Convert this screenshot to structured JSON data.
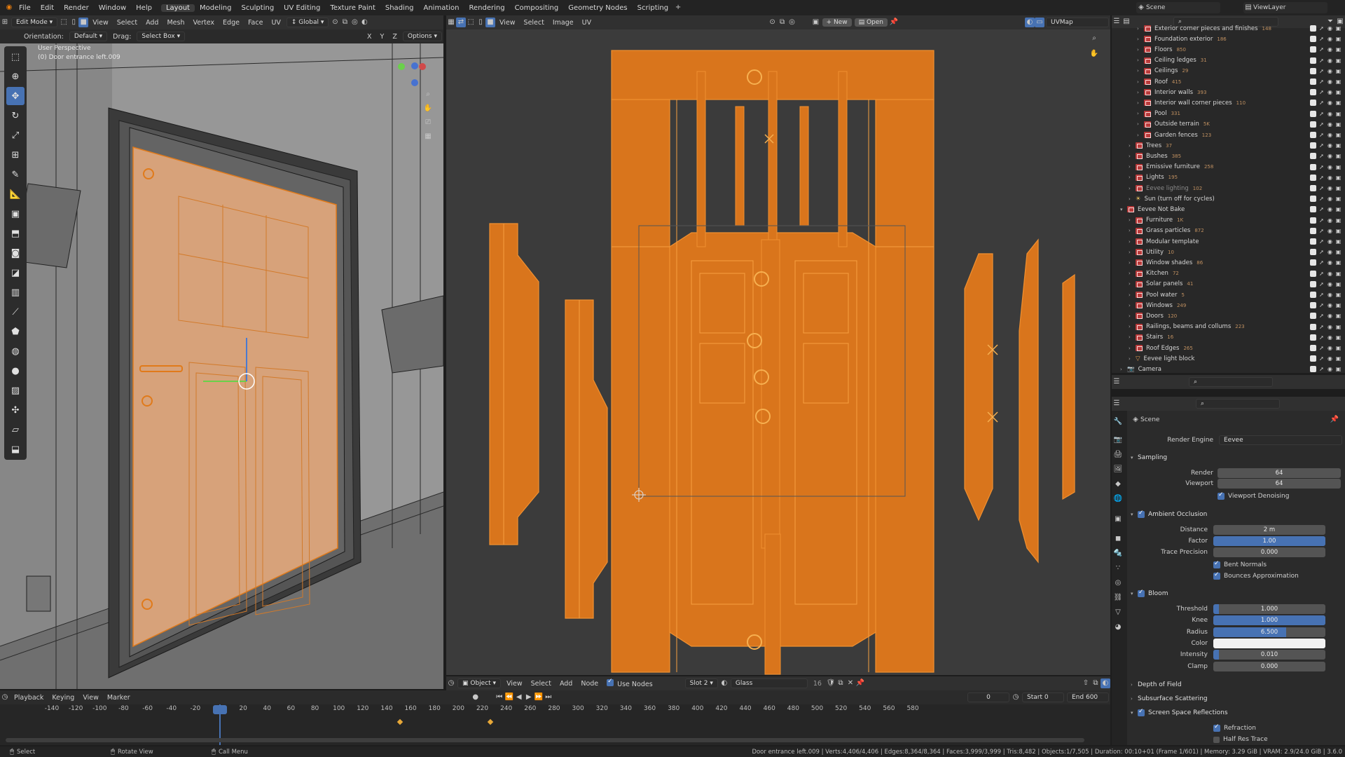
{
  "topbar": {
    "menus": [
      "File",
      "Edit",
      "Render",
      "Window",
      "Help"
    ],
    "workspaces": [
      "Layout",
      "Modeling",
      "Sculpting",
      "UV Editing",
      "Texture Paint",
      "Shading",
      "Animation",
      "Rendering",
      "Compositing",
      "Geometry Nodes",
      "Scripting"
    ],
    "active_workspace": "Layout",
    "scene": "Scene",
    "view_layer": "ViewLayer"
  },
  "viewport": {
    "mode": "Edit Mode",
    "menus": [
      "View",
      "Select",
      "Add",
      "Mesh",
      "Vertex",
      "Edge",
      "Face",
      "UV"
    ],
    "transform_orientation": "Global",
    "orientation_label": "Orientation:",
    "orientation_value": "Default",
    "drag_label": "Drag:",
    "drag_value": "Select Box",
    "axes": [
      "X",
      "Y",
      "Z"
    ],
    "options": "Options",
    "perspective": "User Perspective",
    "object_name": "(0) Door entrance left.009"
  },
  "uv_editor": {
    "menus": [
      "View",
      "Select",
      "Image",
      "UV"
    ],
    "new_button": "New",
    "open_button": "Open",
    "uvmap": "UVMap"
  },
  "node_header": {
    "mode": "Object",
    "menus": [
      "View",
      "Select",
      "Add",
      "Node"
    ],
    "use_nodes": "Use Nodes",
    "slot": "Slot 2",
    "material": "Glass",
    "users": "16"
  },
  "outliner": {
    "rows": [
      {
        "label": "Exterior corner pieces and finishes",
        "count": "148",
        "indent": 2,
        "dim": false
      },
      {
        "label": "Foundation exterior",
        "count": "186",
        "indent": 2,
        "dim": false
      },
      {
        "label": "Floors",
        "count": "850",
        "indent": 2,
        "dim": false
      },
      {
        "label": "Ceiling ledges",
        "count": "31",
        "indent": 2,
        "dim": false
      },
      {
        "label": "Ceilings",
        "count": "29",
        "indent": 2,
        "dim": false
      },
      {
        "label": "Roof",
        "count": "415",
        "indent": 2,
        "dim": false
      },
      {
        "label": "Interior walls",
        "count": "393",
        "indent": 2,
        "dim": false
      },
      {
        "label": "Interior wall corner pieces",
        "count": "110",
        "indent": 2,
        "dim": false
      },
      {
        "label": "Pool",
        "count": "331",
        "indent": 2,
        "dim": false
      },
      {
        "label": "Outside terrain",
        "count": "5K",
        "indent": 2,
        "dim": false
      },
      {
        "label": "Garden fences",
        "count": "123",
        "indent": 2,
        "dim": false
      },
      {
        "label": "Trees",
        "count": "37",
        "indent": 1,
        "dim": false
      },
      {
        "label": "Bushes",
        "count": "385",
        "indent": 1,
        "dim": false
      },
      {
        "label": "Emissive furniture",
        "count": "258",
        "indent": 1,
        "dim": false
      },
      {
        "label": "Lights",
        "count": "195",
        "indent": 1,
        "dim": false
      },
      {
        "label": "Eevee lighting",
        "count": "102",
        "indent": 1,
        "dim": true
      },
      {
        "label": "Sun (turn off for cycles)",
        "count": "",
        "indent": 1,
        "dim": false
      },
      {
        "label": "Eevee Not Bake",
        "count": "",
        "indent": 0,
        "dim": false
      },
      {
        "label": "Furniture",
        "count": "1K",
        "indent": 1,
        "dim": false
      },
      {
        "label": "Grass particles",
        "count": "872",
        "indent": 1,
        "dim": false
      },
      {
        "label": "Modular template",
        "count": "",
        "indent": 1,
        "dim": false
      },
      {
        "label": "Utility",
        "count": "10",
        "indent": 1,
        "dim": false
      },
      {
        "label": "Window shades",
        "count": "86",
        "indent": 1,
        "dim": false
      },
      {
        "label": "Kitchen",
        "count": "72",
        "indent": 1,
        "dim": false
      },
      {
        "label": "Solar panels",
        "count": "41",
        "indent": 1,
        "dim": false
      },
      {
        "label": "Pool water",
        "count": "5",
        "indent": 1,
        "dim": false
      },
      {
        "label": "Windows",
        "count": "249",
        "indent": 1,
        "dim": false
      },
      {
        "label": "Doors",
        "count": "120",
        "indent": 1,
        "dim": false
      },
      {
        "label": "Railings, beams and collums",
        "count": "223",
        "indent": 1,
        "dim": false
      },
      {
        "label": "Stairs",
        "count": "16",
        "indent": 1,
        "dim": false
      },
      {
        "label": "Roof Edges",
        "count": "265",
        "indent": 1,
        "dim": false
      },
      {
        "label": "Eevee light block",
        "count": "",
        "indent": 1,
        "dim": false
      },
      {
        "label": "Camera",
        "count": "",
        "indent": 0,
        "dim": false
      }
    ]
  },
  "properties": {
    "context": "Scene",
    "render_engine_label": "Render Engine",
    "render_engine": "Eevee",
    "sampling": {
      "title": "Sampling",
      "render_label": "Render",
      "render": "64",
      "viewport_label": "Viewport",
      "viewport": "64",
      "denoise": "Viewport Denoising"
    },
    "ao": {
      "title": "Ambient Occlusion",
      "distance_label": "Distance",
      "distance": "2 m",
      "factor_label": "Factor",
      "factor": "1.00",
      "factor_fill": 1.0,
      "trace_label": "Trace Precision",
      "trace": "0.000",
      "bent": "Bent Normals",
      "bounces": "Bounces Approximation"
    },
    "bloom": {
      "title": "Bloom",
      "threshold_label": "Threshold",
      "threshold": "1.000",
      "threshold_fill": 0.05,
      "knee_label": "Knee",
      "knee": "1.000",
      "knee_fill": 1.0,
      "radius_label": "Radius",
      "radius": "6.500",
      "radius_fill": 0.65,
      "color_label": "Color",
      "intensity_label": "Intensity",
      "intensity": "0.010",
      "intensity_fill": 0.05,
      "clamp_label": "Clamp",
      "clamp": "0.000"
    },
    "dof": "Depth of Field",
    "sss": "Subsurface Scattering",
    "ssr": {
      "title": "Screen Space Reflections",
      "refraction": "Refraction",
      "half_res": "Half Res Trace"
    }
  },
  "timeline": {
    "menus": [
      "Playback",
      "Keying",
      "View",
      "Marker"
    ],
    "current_frame": "0",
    "start_label": "Start",
    "start": "0",
    "end_label": "End",
    "end": "600",
    "ticks": [
      "-140",
      "-120",
      "-100",
      "-80",
      "-60",
      "-40",
      "-20",
      "0",
      "20",
      "40",
      "60",
      "80",
      "100",
      "120",
      "140",
      "160",
      "180",
      "200",
      "220",
      "240",
      "260",
      "280",
      "300",
      "320",
      "340",
      "360",
      "380",
      "400",
      "420",
      "440",
      "460",
      "480",
      "500",
      "520",
      "540",
      "560",
      "580"
    ]
  },
  "statusbar": {
    "select": "Select",
    "rotate": "Rotate View",
    "call_menu": "Call Menu",
    "stats": "Door entrance left.009 | Verts:4,406/4,406 | Edges:8,364/8,364 | Faces:3,999/3,999 | Tris:8,482 | Objects:1/7,505 | Duration: 00:10+01 (Frame 1/601) | Memory: 3.29 GiB | VRAM: 2.9/24.0 GiB | 3.6.0"
  },
  "colors": {
    "accent": "#4772b3",
    "uv_orange": "#d9751c",
    "bg": "#1d1d1d",
    "header": "#303030"
  }
}
